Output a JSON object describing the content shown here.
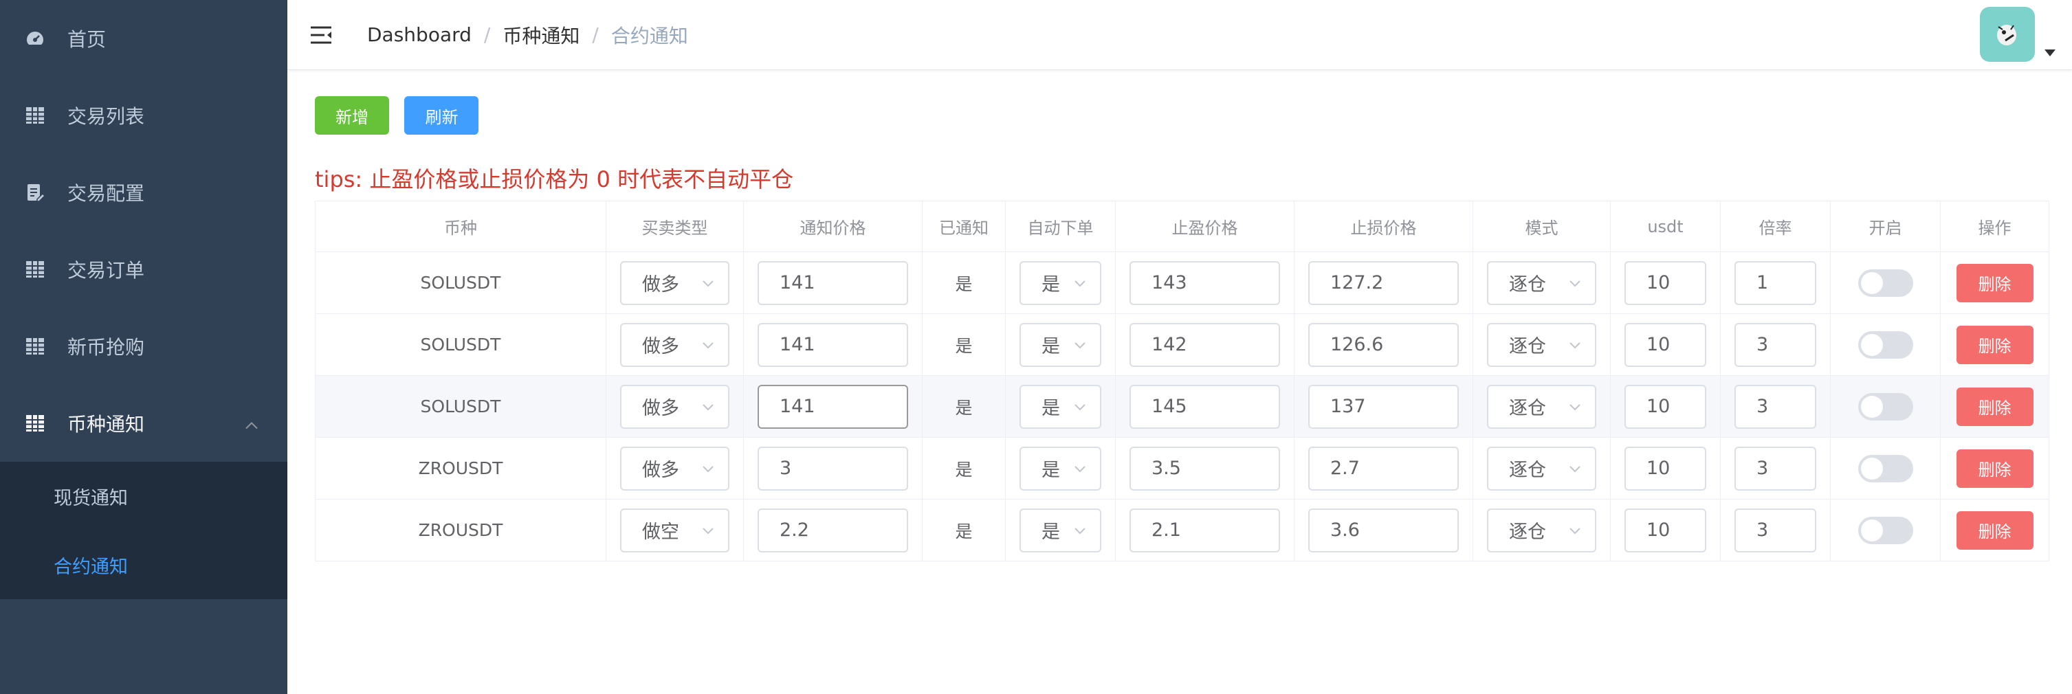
{
  "sidebar": {
    "items": [
      {
        "label": "首页",
        "icon": "dashboard-icon"
      },
      {
        "label": "交易列表",
        "icon": "table-icon"
      },
      {
        "label": "交易配置",
        "icon": "edit-icon"
      },
      {
        "label": "交易订单",
        "icon": "table-icon"
      },
      {
        "label": "新币抢购",
        "icon": "table-icon"
      },
      {
        "label": "币种通知",
        "icon": "table-icon"
      }
    ],
    "submenu": [
      {
        "label": "现货通知"
      },
      {
        "label": "合约通知"
      }
    ]
  },
  "header": {
    "breadcrumb": [
      "Dashboard",
      "币种通知",
      "合约通知"
    ]
  },
  "toolbar": {
    "add_label": "新增",
    "refresh_label": "刷新"
  },
  "tips": "tips: 止盈价格或止损价格为 0 时代表不自动平仓",
  "table": {
    "headers": [
      "币种",
      "买卖类型",
      "通知价格",
      "已通知",
      "自动下单",
      "止盈价格",
      "止损价格",
      "模式",
      "usdt",
      "倍率",
      "开启",
      "操作"
    ],
    "delete_label": "删除",
    "rows": [
      {
        "symbol": "SOLUSDT",
        "side": "做多",
        "notify_price": "141",
        "notified": "是",
        "auto_order": "是",
        "take_profit": "143",
        "stop_loss": "127.2",
        "mode": "逐仓",
        "usdt": "10",
        "leverage": "1",
        "enabled": false
      },
      {
        "symbol": "SOLUSDT",
        "side": "做多",
        "notify_price": "141",
        "notified": "是",
        "auto_order": "是",
        "take_profit": "142",
        "stop_loss": "126.6",
        "mode": "逐仓",
        "usdt": "10",
        "leverage": "3",
        "enabled": false
      },
      {
        "symbol": "SOLUSDT",
        "side": "做多",
        "notify_price": "141",
        "notified": "是",
        "auto_order": "是",
        "take_profit": "145",
        "stop_loss": "137",
        "mode": "逐仓",
        "usdt": "10",
        "leverage": "3",
        "enabled": false
      },
      {
        "symbol": "ZROUSDT",
        "side": "做多",
        "notify_price": "3",
        "notified": "是",
        "auto_order": "是",
        "take_profit": "3.5",
        "stop_loss": "2.7",
        "mode": "逐仓",
        "usdt": "10",
        "leverage": "3",
        "enabled": false
      },
      {
        "symbol": "ZROUSDT",
        "side": "做空",
        "notify_price": "2.2",
        "notified": "是",
        "auto_order": "是",
        "take_profit": "2.1",
        "stop_loss": "3.6",
        "mode": "逐仓",
        "usdt": "10",
        "leverage": "3",
        "enabled": false
      }
    ]
  },
  "colors": {
    "sidebar_bg": "#304156",
    "submenu_bg": "#1f2d3d",
    "active": "#409eff",
    "success": "#67c23a",
    "danger": "#f56c6c",
    "tips": "#d63a2f"
  }
}
